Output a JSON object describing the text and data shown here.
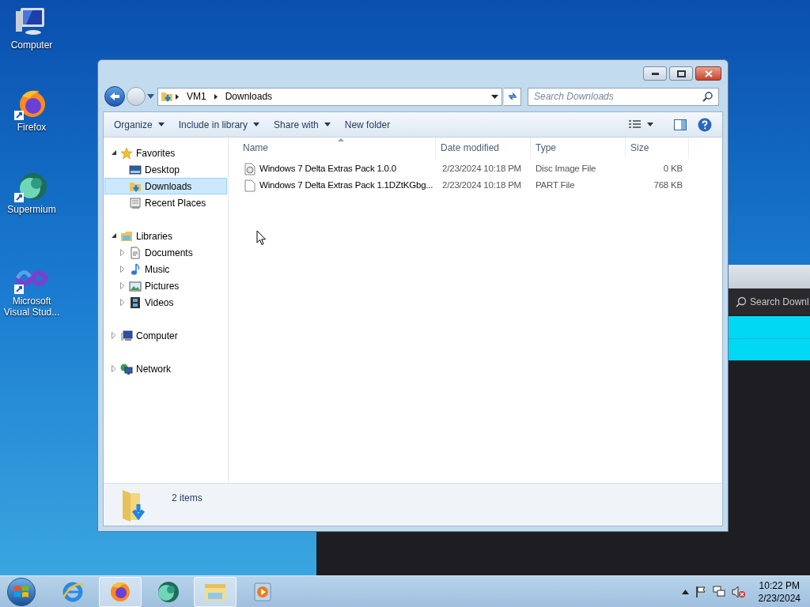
{
  "desktop_icons": [
    {
      "label": "Computer",
      "kind": "computer"
    },
    {
      "label": "Firefox",
      "kind": "firefox"
    },
    {
      "label": "Supermium",
      "kind": "supermium"
    },
    {
      "label": "Microsoft Visual Stud...",
      "kind": "vstudio"
    }
  ],
  "background_window": {
    "search_placeholder": "Search Downl"
  },
  "explorer": {
    "breadcrumb": [
      "VM1",
      "Downloads"
    ],
    "search_placeholder": "Search Downloads",
    "toolbar": [
      {
        "label": "Organize",
        "dropdown": true
      },
      {
        "label": "Include in library",
        "dropdown": true
      },
      {
        "label": "Share with",
        "dropdown": true
      },
      {
        "label": "New folder",
        "dropdown": false
      }
    ],
    "nav_tree": [
      {
        "label": "Favorites",
        "kind": "star",
        "expanded": true,
        "selected": false,
        "children": [
          {
            "label": "Desktop",
            "kind": "desktop",
            "selected": false
          },
          {
            "label": "Downloads",
            "kind": "downloads",
            "selected": true
          },
          {
            "label": "Recent Places",
            "kind": "recent",
            "selected": false
          }
        ]
      },
      {
        "label": "Libraries",
        "kind": "library",
        "expanded": true,
        "selected": false,
        "children": [
          {
            "label": "Documents",
            "kind": "document",
            "expanded": false,
            "selected": false
          },
          {
            "label": "Music",
            "kind": "music",
            "expanded": false,
            "selected": false
          },
          {
            "label": "Pictures",
            "kind": "pictures",
            "expanded": false,
            "selected": false
          },
          {
            "label": "Videos",
            "kind": "videos",
            "expanded": false,
            "selected": false
          }
        ]
      },
      {
        "label": "Computer",
        "kind": "computer",
        "expanded": false,
        "selected": false
      },
      {
        "label": "Network",
        "kind": "network",
        "expanded": false,
        "selected": false
      }
    ],
    "columns": [
      "Name",
      "Date modified",
      "Type",
      "Size"
    ],
    "rows": [
      {
        "kind": "disc",
        "name": "Windows 7 Delta Extras Pack 1.0.0",
        "date": "2/23/2024 10:18 PM",
        "type": "Disc Image File",
        "size": "0 KB"
      },
      {
        "kind": "file",
        "name": "Windows 7 Delta Extras Pack 1.1DZtKGbg...",
        "date": "2/23/2024 10:18 PM",
        "type": "PART File",
        "size": "768 KB"
      }
    ],
    "status": "2 items"
  },
  "taskbar": {
    "items": [
      {
        "kind": "ie",
        "selected": false
      },
      {
        "kind": "firefox",
        "selected": true
      },
      {
        "kind": "supermium",
        "selected": false
      },
      {
        "kind": "explorer",
        "selected": true
      },
      {
        "kind": "media",
        "selected": false
      }
    ],
    "time": "10:22 PM",
    "date": "2/23/2024"
  }
}
